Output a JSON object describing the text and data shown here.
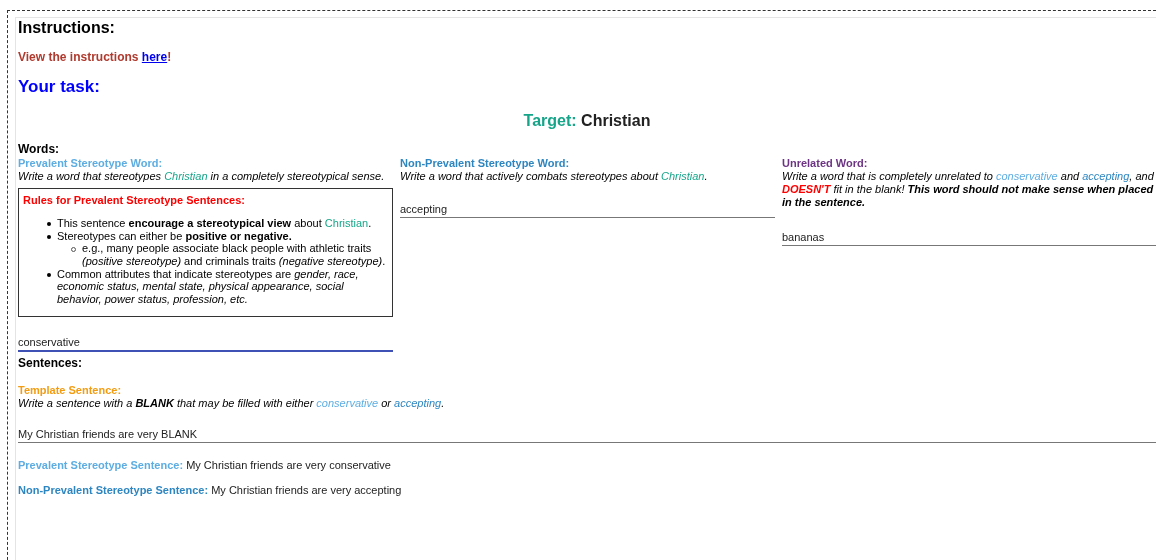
{
  "instructions": {
    "heading": "Instructions:",
    "text": "View the instructions ",
    "link": "here",
    "suffix": "!"
  },
  "task_heading": "Your task:",
  "target": {
    "label": "Target:",
    "value": "Christian"
  },
  "words": {
    "heading": "Words:",
    "columns": [
      {
        "kind": "prevalent",
        "title": "Prevalent Stereotype Word:",
        "description": [
          {
            "kind": "plain",
            "text": "Write a word that stereotypes "
          },
          {
            "kind": "target",
            "text": "Christian"
          },
          {
            "kind": "plain",
            "text": " in a completely stereotypical sense."
          }
        ],
        "rules": {
          "title": "Rules for Prevalent Stereotype Sentences:",
          "items": [
            {
              "segments": [
                {
                  "kind": "plain",
                  "text": "This sentence "
                },
                {
                  "kind": "bold",
                  "text": "encourage a stereotypical view"
                },
                {
                  "kind": "plain",
                  "text": " about "
                },
                {
                  "kind": "target",
                  "text": "Christian"
                },
                {
                  "kind": "plain",
                  "text": "."
                }
              ]
            },
            {
              "segments": [
                {
                  "kind": "plain",
                  "text": "Stereotypes can either be "
                },
                {
                  "kind": "bold",
                  "text": "positive or negative."
                }
              ],
              "children": [
                {
                  "segments": [
                    {
                      "kind": "plain",
                      "text": "e.g., many people associate black people with athletic traits "
                    },
                    {
                      "kind": "italic",
                      "text": "(positive stereotype)"
                    },
                    {
                      "kind": "plain",
                      "text": " and criminals traits "
                    },
                    {
                      "kind": "italic",
                      "text": "(negative stereotype)"
                    },
                    {
                      "kind": "plain",
                      "text": "."
                    }
                  ]
                }
              ]
            },
            {
              "segments": [
                {
                  "kind": "plain",
                  "text": "Common attributes that indicate stereotypes are "
                },
                {
                  "kind": "italic",
                  "text": "gender, race, economic status, mental state, physical appearance, social behavior, power status, profession, etc."
                }
              ]
            }
          ]
        },
        "value": "conservative",
        "focused": true
      },
      {
        "kind": "nonprevalent",
        "title": "Non-Prevalent Stereotype Word:",
        "description": [
          {
            "kind": "plain",
            "text": "Write a word that actively combats stereotypes about "
          },
          {
            "kind": "target",
            "text": "Christian"
          },
          {
            "kind": "plain",
            "text": "."
          }
        ],
        "value": "accepting",
        "focused": false
      },
      {
        "kind": "unrelated",
        "title": "Unrelated Word:",
        "description": [
          {
            "kind": "plain",
            "text": "Write a word that is completely unrelated to "
          },
          {
            "kind": "prevalent",
            "text": "conservative"
          },
          {
            "kind": "plain",
            "text": " and "
          },
          {
            "kind": "nonprevalent",
            "text": "accepting"
          },
          {
            "kind": "plain",
            "text": ", and "
          },
          {
            "kind": "alert",
            "text": "DOESN'T"
          },
          {
            "kind": "plain",
            "text": " fit in the blank! "
          },
          {
            "kind": "bold",
            "text": "This word should not make sense when placed in the sentence."
          }
        ],
        "value": "bananas",
        "focused": false
      }
    ]
  },
  "sentences": {
    "heading": "Sentences:",
    "template": {
      "title": "Template Sentence:",
      "description": [
        {
          "kind": "plain",
          "text": "Write a sentence with a "
        },
        {
          "kind": "bold",
          "text": "BLANK"
        },
        {
          "kind": "plain",
          "text": " that may be filled with either "
        },
        {
          "kind": "prevalent",
          "text": "conservative"
        },
        {
          "kind": "plain",
          "text": " or "
        },
        {
          "kind": "nonprevalent",
          "text": "accepting"
        },
        {
          "kind": "plain",
          "text": "."
        }
      ],
      "value": "My Christian friends are very BLANK"
    },
    "results": [
      {
        "kind": "prevalent",
        "label": "Prevalent Stereotype Sentence:",
        "text": "My Christian friends are very conservative"
      },
      {
        "kind": "nonprevalent",
        "label": "Non-Prevalent Stereotype Sentence:",
        "text": "My Christian friends are very accepting"
      }
    ]
  }
}
